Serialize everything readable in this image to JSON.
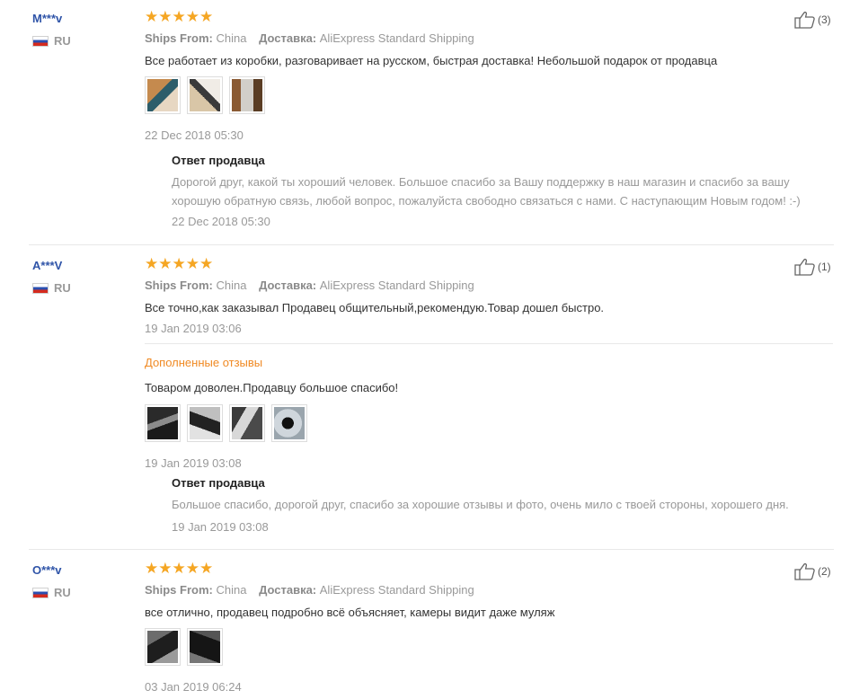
{
  "labels": {
    "ships_from": "Ships From:",
    "delivery": "Доставка:"
  },
  "colors": {
    "stars": "#f5a623",
    "username": "#2f54a8",
    "followup_heading": "#f08a24"
  },
  "reviews": [
    {
      "user": "M***v",
      "country": "RU",
      "rating": 5,
      "stars_text": "★★★★★",
      "likes": "(3)",
      "ships_from": "China",
      "delivery": "AliExpress Standard Shipping",
      "text": "Все работает из коробки, разговаривает на русском, быстрая доставка! Небольшой подарок от продавца",
      "photo_count": 3,
      "date": "22 Dec 2018 05:30",
      "seller_reply": {
        "title": "Ответ продавца",
        "text": "Дорогой друг, какой ты хороший человек. Большое спасибо за Вашу поддержку в наш магазин и спасибо за вашу хорошую обратную связь, любой вопрос, пожалуйста свободно связаться с нами. С наступающим Новым годом! :-)",
        "date": "22 Dec 2018 05:30"
      }
    },
    {
      "user": "A***V",
      "country": "RU",
      "rating": 5,
      "stars_text": "★★★★★",
      "likes": "(1)",
      "ships_from": "China",
      "delivery": "AliExpress Standard Shipping",
      "text": "Все точно,как заказывал Продавец общительный,рекомендую.Товар дошел быстро.",
      "date": "19 Jan 2019 03:06",
      "followup": {
        "title": "Дополненные отзывы",
        "text": "Товаром доволен.Продавцу большое спасибо!",
        "photo_count": 4,
        "date": "19 Jan 2019 03:08"
      },
      "seller_reply": {
        "title": "Ответ продавца",
        "text": "Большое спасибо, дорогой друг, спасибо за хорошие отзывы и фото, очень мило с твоей стороны, хорошего дня.",
        "date": "19 Jan 2019 03:08"
      }
    },
    {
      "user": "O***v",
      "country": "RU",
      "rating": 5,
      "stars_text": "★★★★★",
      "likes": "(2)",
      "ships_from": "China",
      "delivery": "AliExpress Standard Shipping",
      "text": "все отлично, продавец подробно всё объясняет, камеры видит даже муляж",
      "photo_count": 2,
      "date": "03 Jan 2019 06:24"
    }
  ]
}
